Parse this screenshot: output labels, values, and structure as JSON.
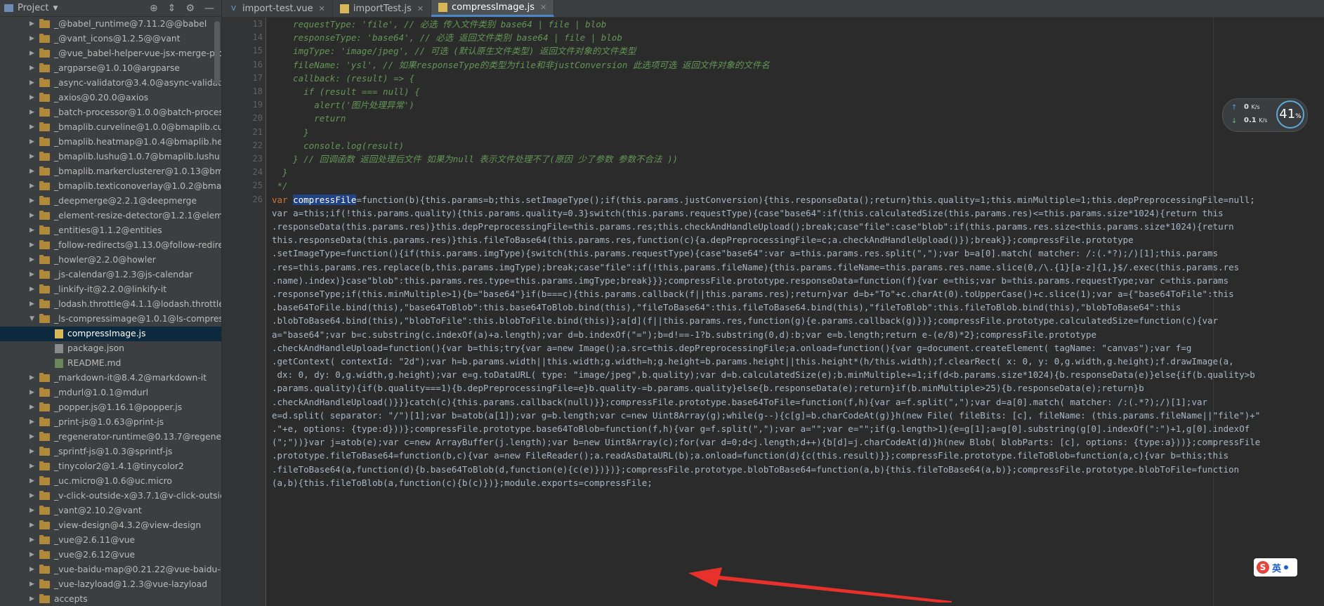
{
  "panel": {
    "title": "Project",
    "tree": [
      {
        "label": "_@babel_runtime@7.11.2@@babel",
        "kind": "folder",
        "arrow": "▶"
      },
      {
        "label": "_@vant_icons@1.2.5@@vant",
        "kind": "folder",
        "arrow": "▶"
      },
      {
        "label": "_@vue_babel-helper-vue-jsx-merge-prop",
        "kind": "folder",
        "arrow": "▶"
      },
      {
        "label": "_argparse@1.0.10@argparse",
        "kind": "folder",
        "arrow": "▶"
      },
      {
        "label": "_async-validator@3.4.0@async-validator",
        "kind": "folder",
        "arrow": "▶"
      },
      {
        "label": "_axios@0.20.0@axios",
        "kind": "folder",
        "arrow": "▶"
      },
      {
        "label": "_batch-processor@1.0.0@batch-processo",
        "kind": "folder",
        "arrow": "▶"
      },
      {
        "label": "_bmaplib.curveline@1.0.0@bmaplib.curve",
        "kind": "folder",
        "arrow": "▶"
      },
      {
        "label": "_bmaplib.heatmap@1.0.4@bmaplib.heatr",
        "kind": "folder",
        "arrow": "▶"
      },
      {
        "label": "_bmaplib.lushu@1.0.7@bmaplib.lushu",
        "kind": "folder",
        "arrow": "▶"
      },
      {
        "label": "_bmaplib.markerclusterer@1.0.13@bmap",
        "kind": "folder",
        "arrow": "▶"
      },
      {
        "label": "_bmaplib.texticonoverlay@1.0.2@bmaplib",
        "kind": "folder",
        "arrow": "▶"
      },
      {
        "label": "_deepmerge@2.2.1@deepmerge",
        "kind": "folder",
        "arrow": "▶"
      },
      {
        "label": "_element-resize-detector@1.2.1@elemen",
        "kind": "folder",
        "arrow": "▶"
      },
      {
        "label": "_entities@1.1.2@entities",
        "kind": "folder",
        "arrow": "▶"
      },
      {
        "label": "_follow-redirects@1.13.0@follow-redirect",
        "kind": "folder",
        "arrow": "▶"
      },
      {
        "label": "_howler@2.2.0@howler",
        "kind": "folder",
        "arrow": "▶"
      },
      {
        "label": "_js-calendar@1.2.3@js-calendar",
        "kind": "folder",
        "arrow": "▶"
      },
      {
        "label": "_linkify-it@2.2.0@linkify-it",
        "kind": "folder",
        "arrow": "▶"
      },
      {
        "label": "_lodash.throttle@4.1.1@lodash.throttle",
        "kind": "folder",
        "arrow": "▶"
      },
      {
        "label": "_ls-compressimage@1.0.1@ls-compressi",
        "kind": "folder",
        "arrow": "▼"
      },
      {
        "label": "compressImage.js",
        "kind": "file",
        "icon": "js",
        "selected": true
      },
      {
        "label": "package.json",
        "kind": "file",
        "icon": "json"
      },
      {
        "label": "README.md",
        "kind": "file",
        "icon": "md"
      },
      {
        "label": "_markdown-it@8.4.2@markdown-it",
        "kind": "folder",
        "arrow": "▶"
      },
      {
        "label": "_mdurl@1.0.1@mdurl",
        "kind": "folder",
        "arrow": "▶"
      },
      {
        "label": "_popper.js@1.16.1@popper.js",
        "kind": "folder",
        "arrow": "▶"
      },
      {
        "label": "_print-js@1.0.63@print-js",
        "kind": "folder",
        "arrow": "▶"
      },
      {
        "label": "_regenerator-runtime@0.13.7@regenerat",
        "kind": "folder",
        "arrow": "▶"
      },
      {
        "label": "_sprintf-js@1.0.3@sprintf-js",
        "kind": "folder",
        "arrow": "▶"
      },
      {
        "label": "_tinycolor2@1.4.1@tinycolor2",
        "kind": "folder",
        "arrow": "▶"
      },
      {
        "label": "_uc.micro@1.0.6@uc.micro",
        "kind": "folder",
        "arrow": "▶"
      },
      {
        "label": "_v-click-outside-x@3.7.1@v-click-outside-",
        "kind": "folder",
        "arrow": "▶"
      },
      {
        "label": "_vant@2.10.2@vant",
        "kind": "folder",
        "arrow": "▶"
      },
      {
        "label": "_view-design@4.3.2@view-design",
        "kind": "folder",
        "arrow": "▶"
      },
      {
        "label": "_vue@2.6.11@vue",
        "kind": "folder",
        "arrow": "▶"
      },
      {
        "label": "_vue@2.6.12@vue",
        "kind": "folder",
        "arrow": "▶"
      },
      {
        "label": "_vue-baidu-map@0.21.22@vue-baidu-ma",
        "kind": "folder",
        "arrow": "▶"
      },
      {
        "label": "_vue-lazyload@1.2.3@vue-lazyload",
        "kind": "folder",
        "arrow": "▶"
      },
      {
        "label": "accepts",
        "kind": "folder",
        "arrow": "▶"
      }
    ]
  },
  "tabs": [
    {
      "label": "import-test.vue",
      "icon": "V",
      "active": false
    },
    {
      "label": "importTest.js",
      "icon": "js",
      "active": false
    },
    {
      "label": "compressImage.js",
      "icon": "js",
      "active": true
    }
  ],
  "gutter": [
    "13",
    "14",
    "15",
    "16",
    "17",
    "18",
    "19",
    "20",
    "21",
    "22",
    "23",
    "24",
    "25",
    "26"
  ],
  "comment_lines": [
    "    requestType: 'file', // 必选 传入文件类别 base64 | file | blob",
    "    responseType: 'base64', // 必选 返回文件类别 base64 | file | blob",
    "    imgType: 'image/jpeg', // 可选 (默认原生文件类型) 返回文件对象的文件类型",
    "    fileName: 'ysl', // 如果responseType的类型为file和非justConversion 此选项可选 返回文件对象的文件名",
    "    callback: (result) => {",
    "      if (result === null) {",
    "        alert('图片处理异常')",
    "        return",
    "      }",
    "      console.log(result)",
    "    } // 回调函数 返回处理后文件 如果为null 表示文件处理不了(原因 少了参数 参数不合法 ))",
    "  }",
    " */"
  ],
  "code_line_26": {
    "kw": "var ",
    "ident": "compressFile",
    "rest": "=function(b){this.params=b;this.setImageType();if(this.params.justConversion){this.responseData();return}this.quality=1;this.minMultiple=1;this.depPreprocessingFile=null;"
  },
  "minified_lines": [
    "var a=this;if(!this.params.quality){this.params.quality=0.3}switch(this.params.requestType){case\"base64\":if(this.calculatedSize(this.params.res)<=this.params.size*1024){return this",
    ".responseData(this.params.res)}this.depPreprocessingFile=this.params.res;this.checkAndHandleUpload();break;case\"file\":case\"blob\":if(this.params.res.size<this.params.size*1024){return",
    "this.responseData(this.params.res)}this.fileToBase64(this.params.res,function(c){a.depPreprocessingFile=c;a.checkAndHandleUpload()});break}};compressFile.prototype",
    ".setImageType=function(){if(this.params.imgType){switch(this.params.requestType){case\"base64\":var a=this.params.res.split(\",\");var b=a[0].match( matcher: /:(.*?);/)[1];this.params",
    ".res=this.params.res.replace(b,this.params.imgType);break;case\"file\":if(!this.params.fileName){this.params.fileName=this.params.res.name.slice(0,/\\.{1}[a-z]{1,}$/.exec(this.params.res",
    ".name).index)}case\"blob\":this.params.res.type=this.params.imgType;break}}};compressFile.prototype.responseData=function(f){var e=this;var b=this.params.requestType;var c=this.params",
    ".responseType;if(this.minMultiple>1){b=\"base64\"}if(b===c){this.params.callback(f||this.params.res);return}var d=b+\"To\"+c.charAt(0).toUpperCase()+c.slice(1);var a={\"base64ToFile\":this",
    ".base64ToFile.bind(this),\"base64ToBlob\":this.base64ToBlob.bind(this),\"fileToBase64\":this.fileToBase64.bind(this),\"fileToBlob\":this.fileToBlob.bind(this),\"blobToBase64\":this",
    ".blobToBase64.bind(this),\"blobToFile\":this.blobToFile.bind(this)};a[d](f||this.params.res,function(g){e.params.callback(g)})};compressFile.prototype.calculatedSize=function(c){var",
    "a=\"base64\";var b=c.substring(c.indexOf(a)+a.length);var d=b.indexOf(\"=\");b=d!==-1?b.substring(0,d):b;var e=b.length;return e-(e/8)*2};compressFile.prototype",
    ".checkAndHandleUpload=function(){var b=this;try{var a=new Image();a.src=this.depPreprocessingFile;a.onload=function(){var g=document.createElement( tagName: \"canvas\");var f=g",
    ".getContext( contextId: \"2d\");var h=b.params.width||this.width;g.width=h;g.height=b.params.height||this.height*(h/this.width);f.clearRect( x: 0, y: 0,g.width,g.height);f.drawImage(a,",
    " dx: 0, dy: 0,g.width,g.height);var e=g.toDataURL( type: \"image/jpeg\",b.quality);var d=b.calculatedSize(e);b.minMultiple+=1;if(d<b.params.size*1024){b.responseData(e)}else{if(b.quality>b",
    ".params.quality){if(b.quality===1){b.depPreprocessingFile=e}b.quality-=b.params.quality}else{b.responseData(e);return}if(b.minMultiple>25){b.responseData(e);return}b",
    ".checkAndHandleUpload()}}}catch(c){this.params.callback(null)}};compressFile.prototype.base64ToFile=function(f,h){var a=f.split(\",\");var d=a[0].match( matcher: /:(.*?);/)[1];var",
    "e=d.split( separator: \"/\")[1];var b=atob(a[1]);var g=b.length;var c=new Uint8Array(g);while(g--){c[g]=b.charCodeAt(g)}h(new File( fileBits: [c], fileName: (this.params.fileName||\"file\")+\"",
    ".\"+e, options: {type:d}))};compressFile.prototype.base64ToBlob=function(f,h){var g=f.split(\",\");var a=\"\";var e=\"\";if(g.length>1){e=g[1];a=g[0].substring(g[0].indexOf(\":\")+1,g[0].indexOf",
    "(\";\"))}var j=atob(e);var c=new ArrayBuffer(j.length);var b=new Uint8Array(c);for(var d=0;d<j.length;d++){b[d]=j.charCodeAt(d)}h(new Blob( blobParts: [c], options: {type:a}))};compressFile",
    ".prototype.fileToBase64=function(b,c){var a=new FileReader();a.readAsDataURL(b);a.onload=function(d){c(this.result)}};compressFile.prototype.fileToBlob=function(a,c){var b=this;this",
    ".fileToBase64(a,function(d){b.base64ToBlob(d,function(e){c(e)})})};compressFile.prototype.blobToBase64=function(a,b){this.fileToBase64(a,b)};compressFile.prototype.blobToFile=function",
    "(a,b){this.fileToBlob(a,function(c){b(c)})};module.exports=compressFile;"
  ],
  "speed_widget": {
    "upload": "0",
    "upload_unit": "K/s",
    "download": "0.1",
    "download_unit": "K/s",
    "percent": "41",
    "percent_sign": "%"
  },
  "ime": {
    "label": "英"
  },
  "colors": {
    "annotation_arrow": "#e8312a",
    "selection": "#214283",
    "comment": "#629755"
  }
}
